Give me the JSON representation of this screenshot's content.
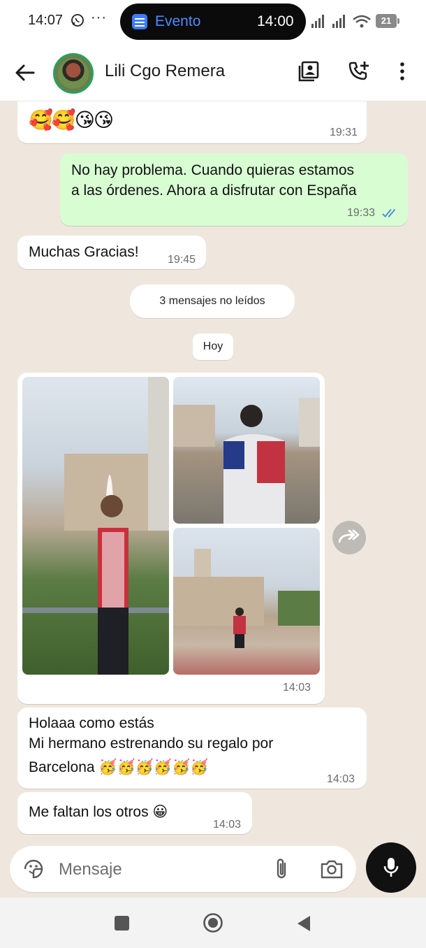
{
  "status_bar": {
    "time": "14:07",
    "overflow": "···",
    "event_label": "Evento",
    "event_time": "14:00",
    "battery": "21"
  },
  "header": {
    "contact_name": "Lili Cgo Remera"
  },
  "messages": [
    {
      "direction": "in",
      "emoji": "🥰🥰😘😘",
      "time": "19:31"
    },
    {
      "direction": "out",
      "text_line1": "No hay problema. Cuando quieras estamos",
      "text_line2": "a las órdenes. Ahora a disfrutar con España",
      "time": "19:33",
      "status": "read"
    },
    {
      "direction": "in",
      "text": "Muchas Gracias!",
      "time": "19:45"
    },
    {
      "direction": "in",
      "type": "photo-album",
      "photo_count": 3,
      "time": "14:03"
    },
    {
      "direction": "in",
      "text_line1": "Holaaa como estás",
      "text_line2": "Mi hermano estrenando su regalo por",
      "text_line3": "Barcelona 🥳🥳🥳🥳🥳🥳",
      "time": "14:03"
    },
    {
      "direction": "in",
      "text": "Me faltan los otros 😀",
      "time": "14:03"
    }
  ],
  "unread_notice": "3 mensajes no leídos",
  "date_divider": "Hoy",
  "composer": {
    "placeholder": "Mensaje"
  },
  "icons": {
    "back": "arrow-left-icon",
    "contact": "contact-card-icon",
    "call": "add-call-icon",
    "more": "more-vert-icon",
    "sticker": "sticker-icon",
    "attach": "paperclip-icon",
    "camera": "camera-icon",
    "mic": "mic-icon",
    "forward": "forward-icon",
    "read_ticks": "double-check-icon"
  },
  "colors": {
    "outgoing_bubble": "#d8fdd3",
    "incoming_bubble": "#ffffff",
    "chat_background": "#efe7de",
    "read_tick": "#3b8de0",
    "online_ring": "#25a35a",
    "event_accent": "#4d8aff"
  }
}
